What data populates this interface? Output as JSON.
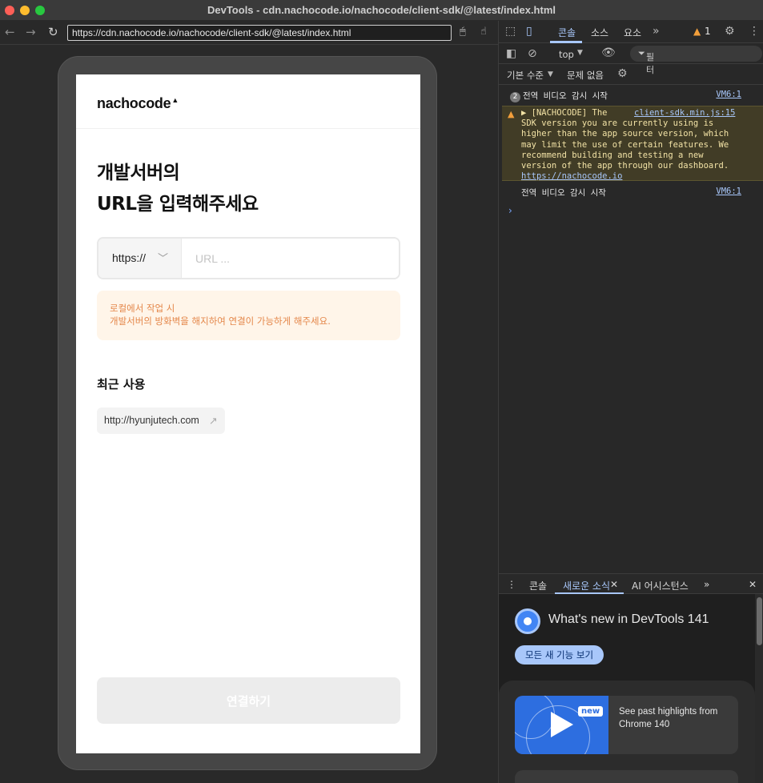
{
  "window": {
    "title": "DevTools - cdn.nachocode.io/nachocode/client-sdk/@latest/index.html"
  },
  "browser": {
    "url": "https://cdn.nachocode.io/nachocode/client-sdk/@latest/index.html"
  },
  "app": {
    "logo": "nachocode",
    "heading_line1": "개발서버의",
    "heading_line2": "URL을 입력해주세요",
    "protocol": "https://",
    "url_placeholder": "URL ...",
    "notice_line1": "로컬에서 작업 시",
    "notice_line2": "개발서버의 방화벽을 해지하여 연결이 가능하게 해주세요.",
    "recent_title": "최근 사용",
    "recent_items": [
      "http://hyunjutech.com"
    ],
    "connect_label": "연결하기"
  },
  "devtools": {
    "tabs": [
      "콘솔",
      "소스",
      "요소"
    ],
    "warning_count": "1",
    "context": "top",
    "filter_placeholder": "필터",
    "level": "기본 수준",
    "issues": "문제 없음",
    "logs": [
      {
        "count": "2",
        "text": "전역 비디오 감시 시작",
        "source": "VM6:1"
      },
      {
        "count": "",
        "text": "전역 비디오 감시 시작",
        "source": "VM6:1"
      }
    ],
    "warning": {
      "prefix": "▶ [NACHOCODE]  The",
      "source": "client-sdk.min.js:15",
      "body": "SDK version you are currently using is higher than the app source version, which may limit the use of certain features. We recommend building and testing a new version of the app through our dashboard.",
      "link": "https://nachocode.io"
    },
    "drawer_tabs": [
      "콘솔",
      "새로운 소식",
      "AI 어시스턴스"
    ],
    "whats_new_title": "What's new in DevTools 141",
    "see_all_label": "모든 새 기능 보기",
    "card_badge": "new",
    "card_text": "See past highlights from Chrome 140"
  }
}
